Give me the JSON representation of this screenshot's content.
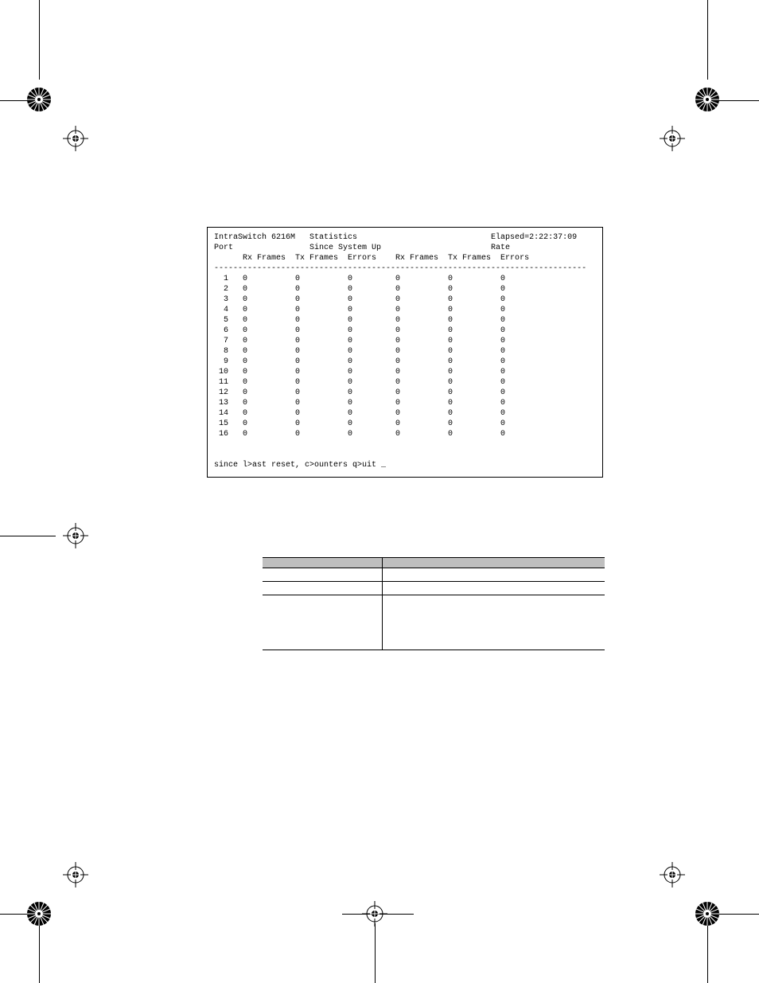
{
  "terminal": {
    "title_left": "IntraSwitch 6216M   Statistics",
    "title_right": "Elapsed=2:22:37:09",
    "sub_left": "Port",
    "sub_mid": "Since System Up",
    "sub_right": "Rate",
    "col_headers": {
      "rx1": "Rx Frames",
      "tx1": "Tx Frames",
      "er1": "Errors",
      "rx2": "Rx Frames",
      "tx2": "Tx Frames",
      "er2": "Errors"
    },
    "rows": [
      {
        "port": "1",
        "a": "0",
        "b": "0",
        "c": "0",
        "d": "0",
        "e": "0",
        "f": "0"
      },
      {
        "port": "2",
        "a": "0",
        "b": "0",
        "c": "0",
        "d": "0",
        "e": "0",
        "f": "0"
      },
      {
        "port": "3",
        "a": "0",
        "b": "0",
        "c": "0",
        "d": "0",
        "e": "0",
        "f": "0"
      },
      {
        "port": "4",
        "a": "0",
        "b": "0",
        "c": "0",
        "d": "0",
        "e": "0",
        "f": "0"
      },
      {
        "port": "5",
        "a": "0",
        "b": "0",
        "c": "0",
        "d": "0",
        "e": "0",
        "f": "0"
      },
      {
        "port": "6",
        "a": "0",
        "b": "0",
        "c": "0",
        "d": "0",
        "e": "0",
        "f": "0"
      },
      {
        "port": "7",
        "a": "0",
        "b": "0",
        "c": "0",
        "d": "0",
        "e": "0",
        "f": "0"
      },
      {
        "port": "8",
        "a": "0",
        "b": "0",
        "c": "0",
        "d": "0",
        "e": "0",
        "f": "0"
      },
      {
        "port": "9",
        "a": "0",
        "b": "0",
        "c": "0",
        "d": "0",
        "e": "0",
        "f": "0"
      },
      {
        "port": "10",
        "a": "0",
        "b": "0",
        "c": "0",
        "d": "0",
        "e": "0",
        "f": "0"
      },
      {
        "port": "11",
        "a": "0",
        "b": "0",
        "c": "0",
        "d": "0",
        "e": "0",
        "f": "0"
      },
      {
        "port": "12",
        "a": "0",
        "b": "0",
        "c": "0",
        "d": "0",
        "e": "0",
        "f": "0"
      },
      {
        "port": "13",
        "a": "0",
        "b": "0",
        "c": "0",
        "d": "0",
        "e": "0",
        "f": "0"
      },
      {
        "port": "14",
        "a": "0",
        "b": "0",
        "c": "0",
        "d": "0",
        "e": "0",
        "f": "0"
      },
      {
        "port": "15",
        "a": "0",
        "b": "0",
        "c": "0",
        "d": "0",
        "e": "0",
        "f": "0"
      },
      {
        "port": "16",
        "a": "0",
        "b": "0",
        "c": "0",
        "d": "0",
        "e": "0",
        "f": "0"
      }
    ],
    "prompt": "since l>ast reset, c>ounters q>uit _"
  },
  "table": {
    "header_left": "",
    "header_right": "",
    "rows": [
      {
        "l": " ",
        "r": " "
      },
      {
        "l": " ",
        "r": " "
      },
      {
        "l": " ",
        "r": " "
      }
    ]
  }
}
